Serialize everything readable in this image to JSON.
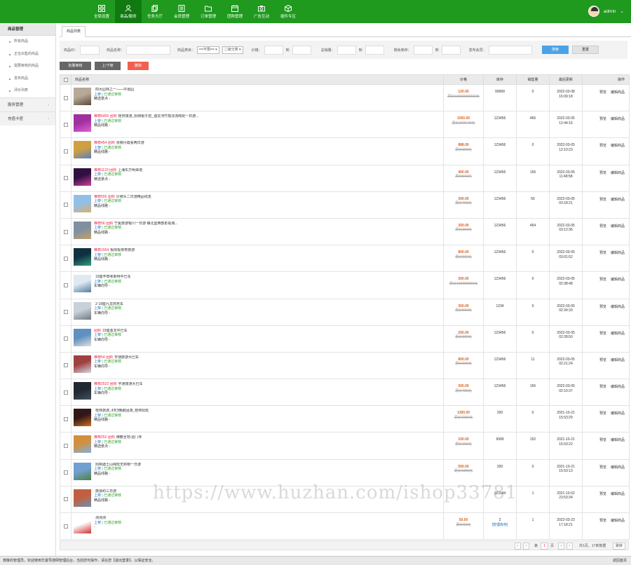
{
  "nav": [
    {
      "label": "全局设置",
      "icon": "grid-icon"
    },
    {
      "label": "商品/服务",
      "icon": "user-icon",
      "active": true
    },
    {
      "label": "任务大厅",
      "icon": "copy-icon"
    },
    {
      "label": "会员管理",
      "icon": "book-icon"
    },
    {
      "label": "订单管理",
      "icon": "folder-icon"
    },
    {
      "label": "团购管理",
      "icon": "calendar-icon"
    },
    {
      "label": "广告互动",
      "icon": "camera-icon"
    },
    {
      "label": "插件专区",
      "icon": "box-icon"
    }
  ],
  "user": {
    "name": "admin"
  },
  "sidebar": {
    "head": "商品管理",
    "items": [
      "所有商品",
      "正在出售的商品",
      "需要审核的商品",
      "发布商品",
      "评价列表"
    ],
    "sections": [
      "服务管理",
      "充值卡密"
    ]
  },
  "tab": "商品列表",
  "filter": {
    "id_label": "商品ID：",
    "name_label": "商品名称：",
    "cat_label": "商品类目：",
    "cat1": "==不限==",
    "cat2": "二级分类",
    "price_label": "价格：",
    "sales_label": "总销量：",
    "stock_label": "剩余库存：",
    "member_label": "发布会员：",
    "to": "到",
    "search": "搜索",
    "reset": "重置"
  },
  "actions": {
    "audit": "批量审核",
    "toggle": "上/下架",
    "delete": "删除"
  },
  "columns": [
    "商品名称",
    "价格",
    "库存",
    "销售量",
    "最后更新",
    "操作"
  ],
  "rows": [
    {
      "tag": "",
      "name": "四大园林之一——中道园",
      "status": "上架",
      "audit": "已通过审核",
      "cat": "精选景点",
      "price": "120.00",
      "old": "原价10000000000元",
      "stock": "99999",
      "sales": "0",
      "date": "2022-03-08",
      "time": "16:09:18",
      "img": [
        "#b8a898",
        "#5a4a3a"
      ]
    },
    {
      "tag": "推荐6455 团购",
      "name": "桂林旅游_阳朔银子岩_遇龙河竹筏漂流纯玩一日游...",
      "status": "上架",
      "audit": "已通过审核",
      "cat": "精品线路",
      "price": "1000.00",
      "old": "原价1600.00元",
      "stock": "123456",
      "sales": "456",
      "date": "2022-03-05",
      "time": "12:44:16",
      "img": [
        "#a030a0",
        "#e060d0"
      ]
    },
    {
      "tag": "推荐454 团购",
      "name": "张掖丹霞看两日游",
      "status": "上架",
      "audit": "已通过审核",
      "cat": "精品线路",
      "price": "888.00",
      "old": "原价900元",
      "stock": "123456",
      "sales": "0",
      "date": "2022-03-05",
      "time": "12:10:23",
      "img": [
        "#d0a040",
        "#5a80c0"
      ]
    },
    {
      "tag": "推荐1123 团购",
      "name": "上海东方明珠塔",
      "status": "上架",
      "audit": "已通过审核",
      "cat": "精选景点",
      "price": "400.00",
      "old": "原价500元",
      "stock": "123456",
      "sales": "156",
      "date": "2022-03-05",
      "time": "11:48:58",
      "img": [
        "#301040",
        "#d040a0"
      ]
    },
    {
      "tag": "推荐555 团购",
      "name": "沙坡头二日游精品线发",
      "status": "上架",
      "audit": "已通过审核",
      "cat": "精品线路",
      "price": "390.00",
      "old": "原价400元",
      "stock": "123456",
      "sales": "56",
      "date": "2022-03-05",
      "time": "03:18:21",
      "img": [
        "#90c0e8",
        "#d8b070"
      ]
    },
    {
      "tag": "推荐56 团购",
      "name": "宁夏旅游银川一日游 镇北堡西部影视城...",
      "status": "上架",
      "audit": "已通过审核",
      "cat": "精品线路",
      "price": "300.00",
      "old": "原价360元",
      "stock": "123456",
      "sales": "454",
      "date": "2022-03-05",
      "time": "03:12:36",
      "img": [
        "#8090a0",
        "#c0a070"
      ]
    },
    {
      "tag": "推荐1564",
      "name": "极限极夜奇旅游",
      "status": "上架",
      "audit": "已通过审核",
      "cat": "精品线路",
      "price": "800.00",
      "old": "原价900元",
      "stock": "123456",
      "sales": "0",
      "date": "2022-03-05",
      "time": "03:01:52",
      "img": [
        "#103040",
        "#30a080"
      ]
    },
    {
      "tag": "",
      "name": "19座丰田考斯特中巴车",
      "status": "上架",
      "audit": "已通过审核",
      "cat": "车辆向导",
      "price": "300.00",
      "old": "原价100000000元",
      "stock": "123456",
      "sales": "0",
      "date": "2022-03-05",
      "time": "02:38:48",
      "img": [
        "#e0e8f0",
        "#5080a0"
      ]
    },
    {
      "tag": "",
      "name": "2-18座九龙商务车",
      "status": "上架",
      "audit": "已通过审核",
      "cat": "车辆向导",
      "price": "300.00",
      "old": "原价500元",
      "stock": "1234",
      "sales": "0",
      "date": "2022-03-05",
      "time": "02:34:33",
      "img": [
        "#c8d0d8",
        "#707880"
      ]
    },
    {
      "tag": "团购",
      "name": "19座金龙中巴车",
      "status": "上架",
      "audit": "已通过审核",
      "cat": "车辆向导",
      "price": "200.00",
      "old": "原价300元",
      "stock": "123456",
      "sales": "0",
      "date": "2022-03-05",
      "time": "02:28:50",
      "img": [
        "#6090c0",
        "#e0e0e0"
      ]
    },
    {
      "tag": "推荐54 团购",
      "name": "宇通旅游大巴车",
      "status": "上架",
      "audit": "已通过审核",
      "cat": "车辆向导",
      "price": "800.00",
      "old": "原价900元",
      "stock": "123456",
      "sales": "11",
      "date": "2022-03-05",
      "time": "02:21:24",
      "img": [
        "#a04040",
        "#d0d8e0"
      ]
    },
    {
      "tag": "推荐2522 团购",
      "name": "宇通旅游大巴车",
      "status": "上架",
      "audit": "已通过审核",
      "cat": "车辆向导",
      "price": "300.00",
      "old": "原价400元",
      "stock": "123456",
      "sales": "156",
      "date": "2022-03-05",
      "time": "02:10:37",
      "img": [
        "#202830",
        "#405060"
      ]
    },
    {
      "tag": "",
      "name": "桂林旅游_4天3晚跟团游_桂林阳玩",
      "status": "上架",
      "audit": "已通过审核",
      "cat": "精品线路",
      "price": "1300.00",
      "old": "原价1600元",
      "stock": "200",
      "sales": "0",
      "date": "2021-10-21",
      "time": "15:53:29",
      "img": [
        "#301818",
        "#d07020"
      ]
    },
    {
      "tag": "推荐252 团购",
      "name": "佛教圣地-远门寺",
      "status": "上架",
      "audit": "已通过审核",
      "cat": "精选景点",
      "price": "100.00",
      "old": "原价200元",
      "stock": "9999",
      "sales": "152",
      "date": "2021-10-21",
      "time": "15:53:22",
      "img": [
        "#d09040",
        "#80b0e0"
      ]
    },
    {
      "tag": "",
      "name": "阳朔遇士山纯玩无购物一日游",
      "status": "上架",
      "audit": "已通过审核",
      "cat": "精品线路",
      "price": "500.00",
      "old": "原价1000元",
      "stock": "200",
      "sales": "0",
      "date": "2021-10-21",
      "time": "15:53:13",
      "img": [
        "#70a0d0",
        "#508040"
      ]
    },
    {
      "tag": "",
      "name": "鼓浪屿三日游",
      "status": "上架",
      "audit": "已通过审核",
      "cat": "精品线路",
      "price": "",
      "old": "",
      "stock": "123144",
      "sales": "1",
      "date": "2021-10-02",
      "time": "23:53:34",
      "img": [
        "#c06040",
        "#7090b0"
      ]
    },
    {
      "tag": "",
      "name": "测测测",
      "status": "上架",
      "audit": "已通过审核",
      "cat": "-",
      "price": "50.00",
      "old": "原价60元",
      "stock": "2",
      "stock_note": "[管理库存]",
      "sales": "1",
      "date": "2022-03-23",
      "time": "17:18:21",
      "img": [
        "#ffffff",
        "#d03030"
      ]
    }
  ],
  "row_ops": {
    "preview": "预览",
    "edit": "编辑商品"
  },
  "pager": {
    "first": "‹",
    "prev": "‹",
    "next": "›",
    "last": "›",
    "page_prefix": "第",
    "page": "1",
    "page_suffix": "页",
    "go": "跳转",
    "summary": "共1页，17条数据"
  },
  "footer": {
    "text": "尊敬的管理员，欢迎使用华夏导游网管理后台，当前您可操作，请在您【退出登录】，以保证安全。",
    "back": "返回首页"
  },
  "watermark": "https://www.huzhan.com/ishop33781"
}
